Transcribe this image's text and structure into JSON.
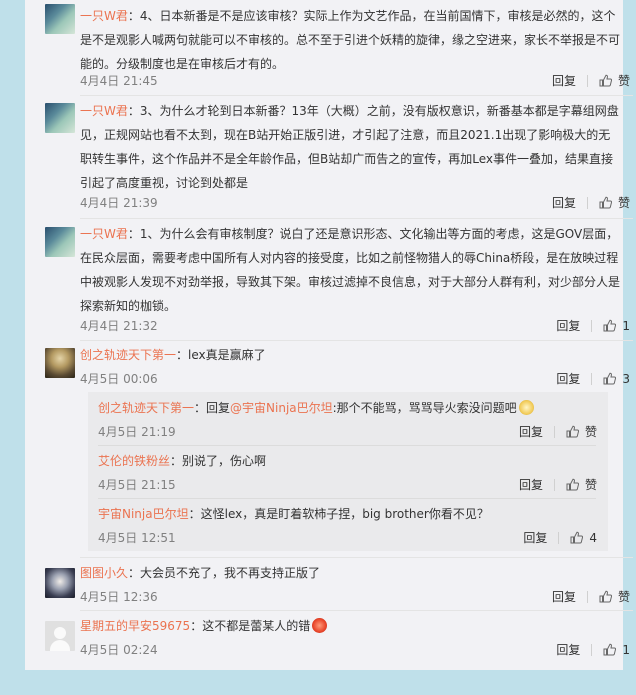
{
  "comments": [
    {
      "user": "一只W君",
      "text": "：4、日本新番是不是应该审核？实际上作为文艺作品，在当前国情下，审核是必然的，这个是不是观影人喊两句就能可以不审核的。总不至于引进个妖精的旋律，缘之空进来，家长不举报是不可能的。分级制度也是在审核后才有的。",
      "time": "4月4日 21:45",
      "reply": "回复",
      "like": "赞"
    },
    {
      "user": "一只W君",
      "text": "：3、为什么才轮到日本新番？13年（大概）之前，没有版权意识，新番基本都是字幕组网盘见，正规网站也看不太到，现在B站开始正版引进，才引起了注意，而且2021.1出现了影响极大的无职转生事件，这个作品并不是全年龄作品，但B站却广而告之的宣传，再加Lex事件一叠加，结果直接引起了高度重视，讨论到处都是",
      "time": "4月4日 21:39",
      "reply": "回复",
      "like": "赞"
    },
    {
      "user": "一只W君",
      "text": "：1、为什么会有审核制度？说白了还是意识形态、文化输出等方面的考虑，这是GOV层面，在民众层面，需要考虑中国所有人对内容的接受度，比如之前怪物猎人的辱China桥段，是在放映过程中被观影人发现不对劲举报，导致其下架。审核过滤掉不良信息，对于大部分人群有利，对少部分人是探索新知的枷锁。",
      "time": "4月4日 21:32",
      "reply": "回复",
      "like": "1"
    },
    {
      "user": "创之轨迹天下第一",
      "text": "：lex真是赢麻了",
      "time": "4月5日 00:06",
      "reply": "回复",
      "like": "3"
    },
    {
      "user": "图图小久",
      "text": "：大会员不充了，我不再支持正版了",
      "time": "4月5日 12:36",
      "reply": "回复",
      "like": "赞"
    },
    {
      "user": "星期五的早安59675",
      "text": "：这不都是蕾某人的错",
      "time": "4月5日 02:24",
      "reply": "回复",
      "like": "1"
    }
  ],
  "replies": [
    {
      "user": "创之轨迹天下第一",
      "mid": "：回复",
      "mention": "@宇宙Ninja巴尔坦",
      "text": ":那个不能骂，骂骂导火索没问题吧",
      "time": "4月5日 21:19",
      "reply": "回复",
      "like": "赞"
    },
    {
      "user": "艾伦的铁粉丝",
      "text": "：别说了，伤心啊",
      "time": "4月5日 21:15",
      "reply": "回复",
      "like": "赞"
    },
    {
      "user": "宇宙Ninja巴尔坦",
      "text": "：这怪lex，真是盯着软柿子捏，big brother你看不见？",
      "time": "4月5日 12:51",
      "reply": "回复",
      "like": "4"
    }
  ]
}
